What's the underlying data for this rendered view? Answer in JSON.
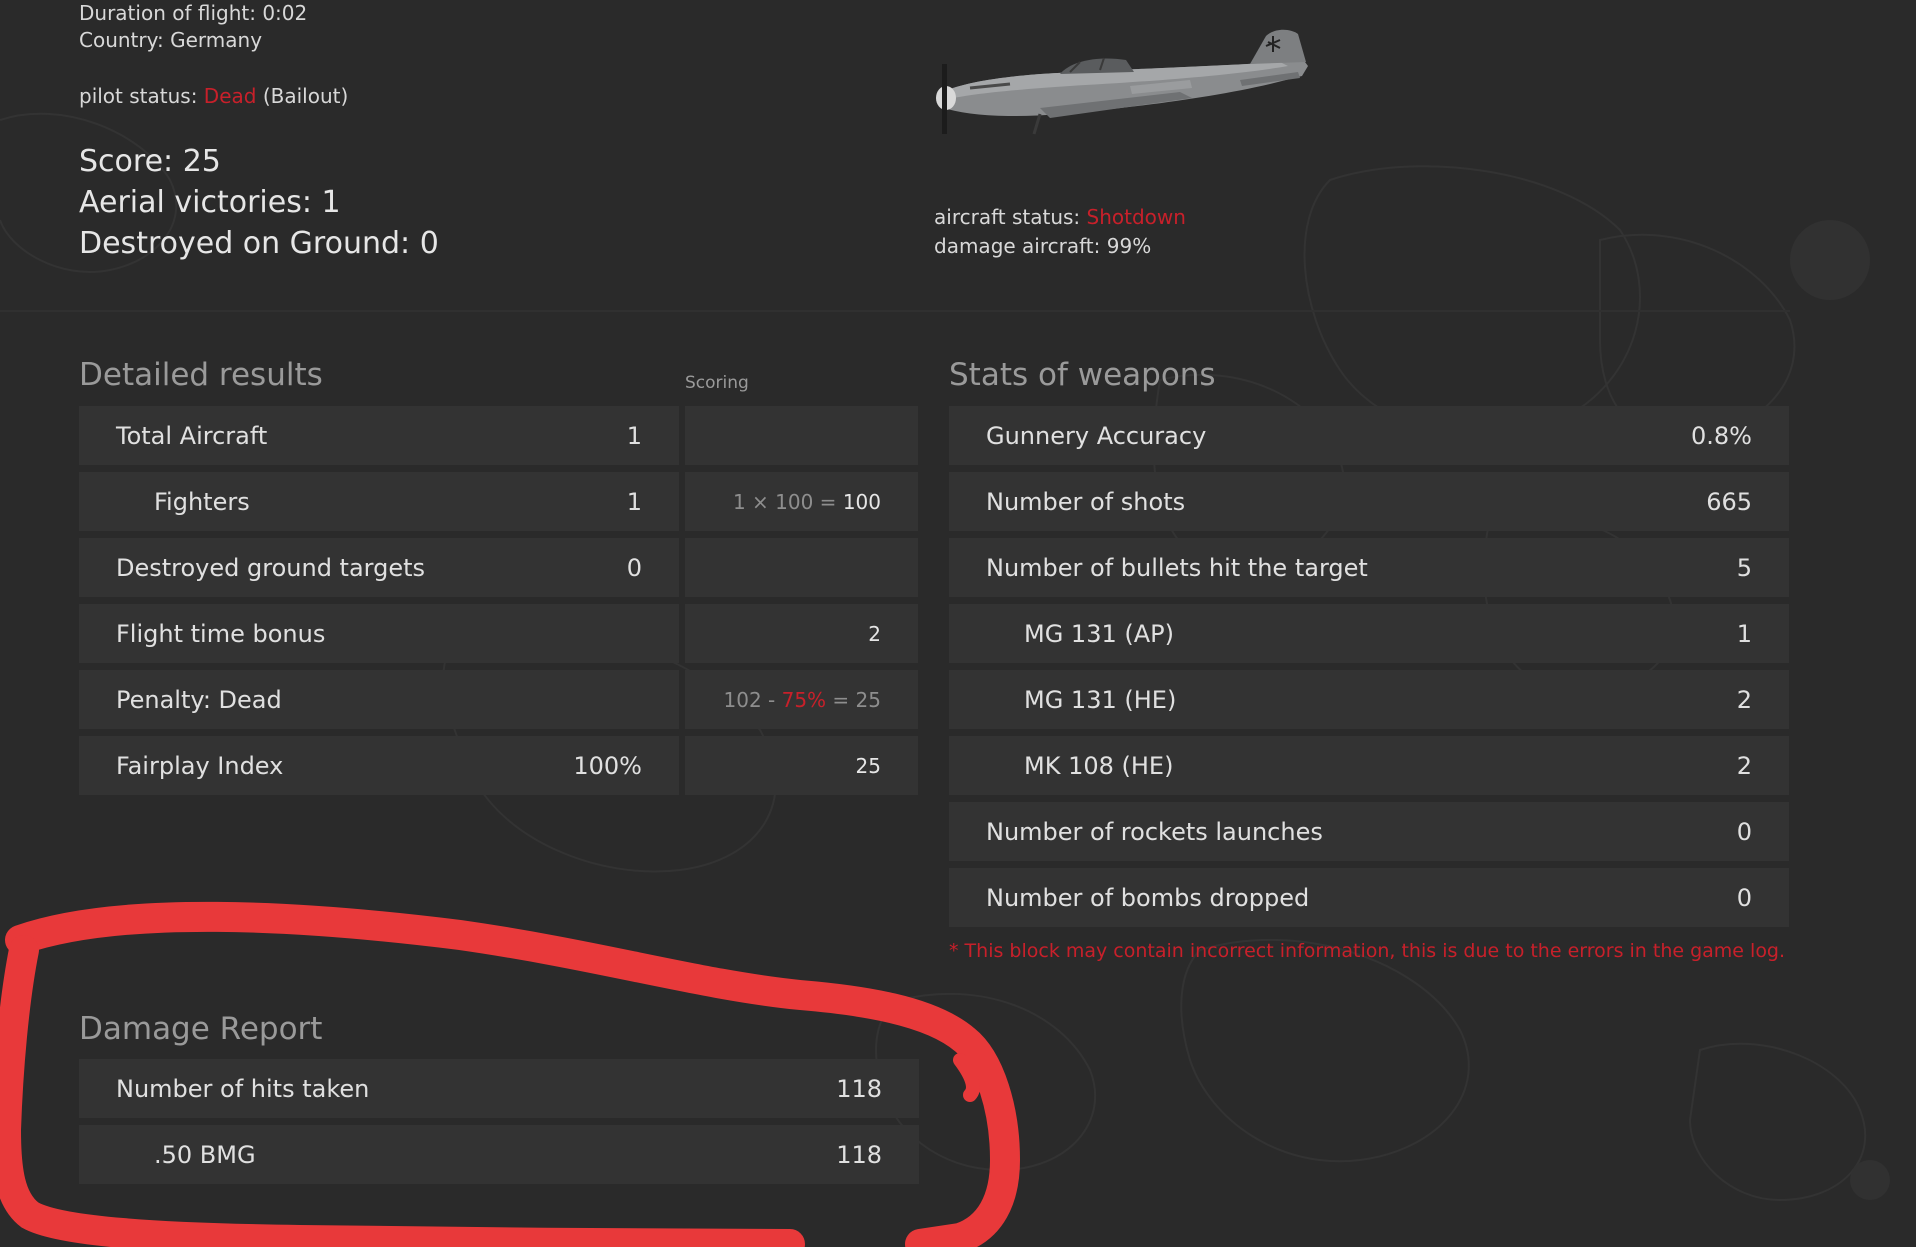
{
  "flight": {
    "duration_label": "Duration of flight:",
    "duration_value": "0:02",
    "country_label": "Country:",
    "country_value": "Germany",
    "pilot_status_label": "pilot status:",
    "pilot_status_value": "Dead",
    "pilot_status_detail": "(Bailout)"
  },
  "summary": {
    "score_label": "Score:",
    "score_value": "25",
    "aerial_label": "Aerial victories:",
    "aerial_value": "1",
    "ground_label": "Destroyed on Ground:",
    "ground_value": "0"
  },
  "aircraft": {
    "status_label": "aircraft status:",
    "status_value": "Shotdown",
    "damage_label": "damage aircraft:",
    "damage_value": "99%"
  },
  "detailed": {
    "title": "Detailed results",
    "scoring_header": "Scoring",
    "rows": [
      {
        "label": "Total Aircraft",
        "value": "1",
        "score": ""
      },
      {
        "label": "Fighters",
        "value": "1",
        "score_prefix": "1 × 100 =",
        "score_result": "100"
      },
      {
        "label": "Destroyed ground targets",
        "value": "0",
        "score": ""
      },
      {
        "label": "Flight time bonus",
        "value": "",
        "score": "2"
      },
      {
        "label": "Penalty: Dead",
        "value": "",
        "score_base": "102 -",
        "score_penalty": "75%",
        "score_eq": "= 25"
      },
      {
        "label": "Fairplay Index",
        "value": "100%",
        "score": "25"
      }
    ]
  },
  "weapons": {
    "title": "Stats of weapons",
    "rows": [
      {
        "label": "Gunnery Accuracy",
        "value": "0.8%"
      },
      {
        "label": "Number of shots",
        "value": "665"
      },
      {
        "label": "Number of bullets hit the target",
        "value": "5"
      },
      {
        "label": "MG 131 (AP)",
        "value": "1"
      },
      {
        "label": "MG 131 (HE)",
        "value": "2"
      },
      {
        "label": "MK 108 (HE)",
        "value": "2"
      },
      {
        "label": "Number of rockets launches",
        "value": "0"
      },
      {
        "label": "Number of bombs dropped",
        "value": "0"
      }
    ],
    "note": "* This block may contain incorrect information, this is due to the errors in the game log."
  },
  "damage": {
    "title": "Damage Report",
    "rows": [
      {
        "label": "Number of hits taken",
        "value": "118"
      },
      {
        "label": ".50 BMG",
        "value": "118"
      }
    ]
  },
  "colors": {
    "background": "#2a2a2a",
    "row_bg": "#333333",
    "status_red": "#c8202a",
    "annotation_red": "#e8393a"
  },
  "icons": {
    "aircraft": "bf109-aircraft-image"
  }
}
